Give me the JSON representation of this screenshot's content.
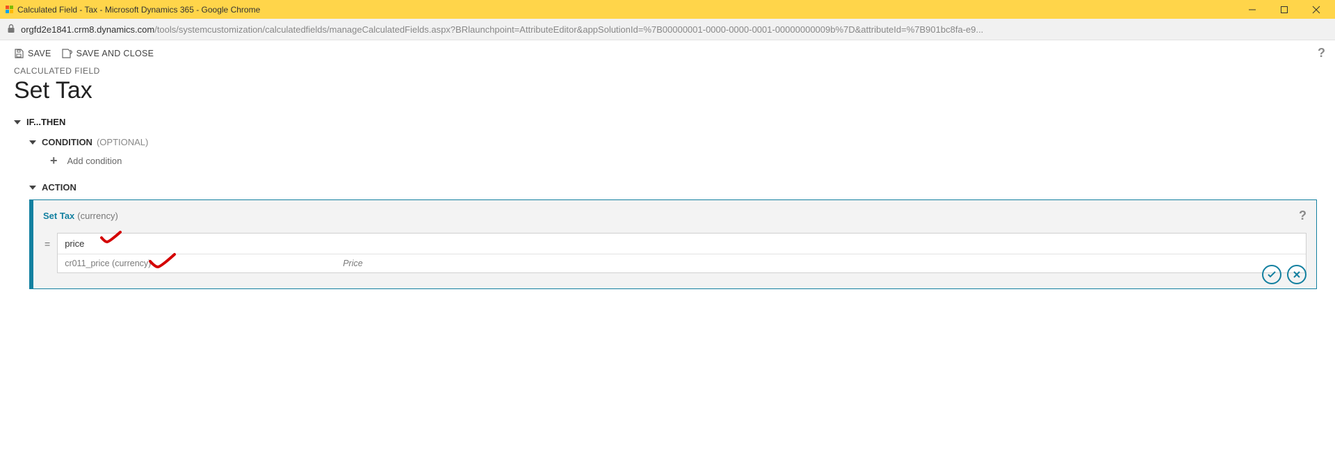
{
  "window": {
    "title": "Calculated Field - Tax - Microsoft Dynamics 365 - Google Chrome"
  },
  "url": {
    "host": "orgfd2e1841.crm8.dynamics.com",
    "path": "/tools/systemcustomization/calculatedfields/manageCalculatedFields.aspx?BRlaunchpoint=AttributeEditor&appSolutionId=%7B00000001-0000-0000-0001-00000000009b%7D&attributeId=%7B901bc8fa-e9..."
  },
  "commands": {
    "save": "SAVE",
    "save_close": "SAVE AND CLOSE"
  },
  "page": {
    "section_label": "CALCULATED FIELD",
    "title": "Set Tax"
  },
  "ifthen": {
    "heading": "IF...THEN"
  },
  "condition": {
    "label": "CONDITION",
    "optional": "(OPTIONAL)",
    "add": "Add condition"
  },
  "action": {
    "label": "ACTION",
    "title": "Set Tax",
    "type": "(currency)",
    "input_value": "price",
    "suggestion_schema": "cr011_price (currency)",
    "suggestion_display": "Price"
  }
}
